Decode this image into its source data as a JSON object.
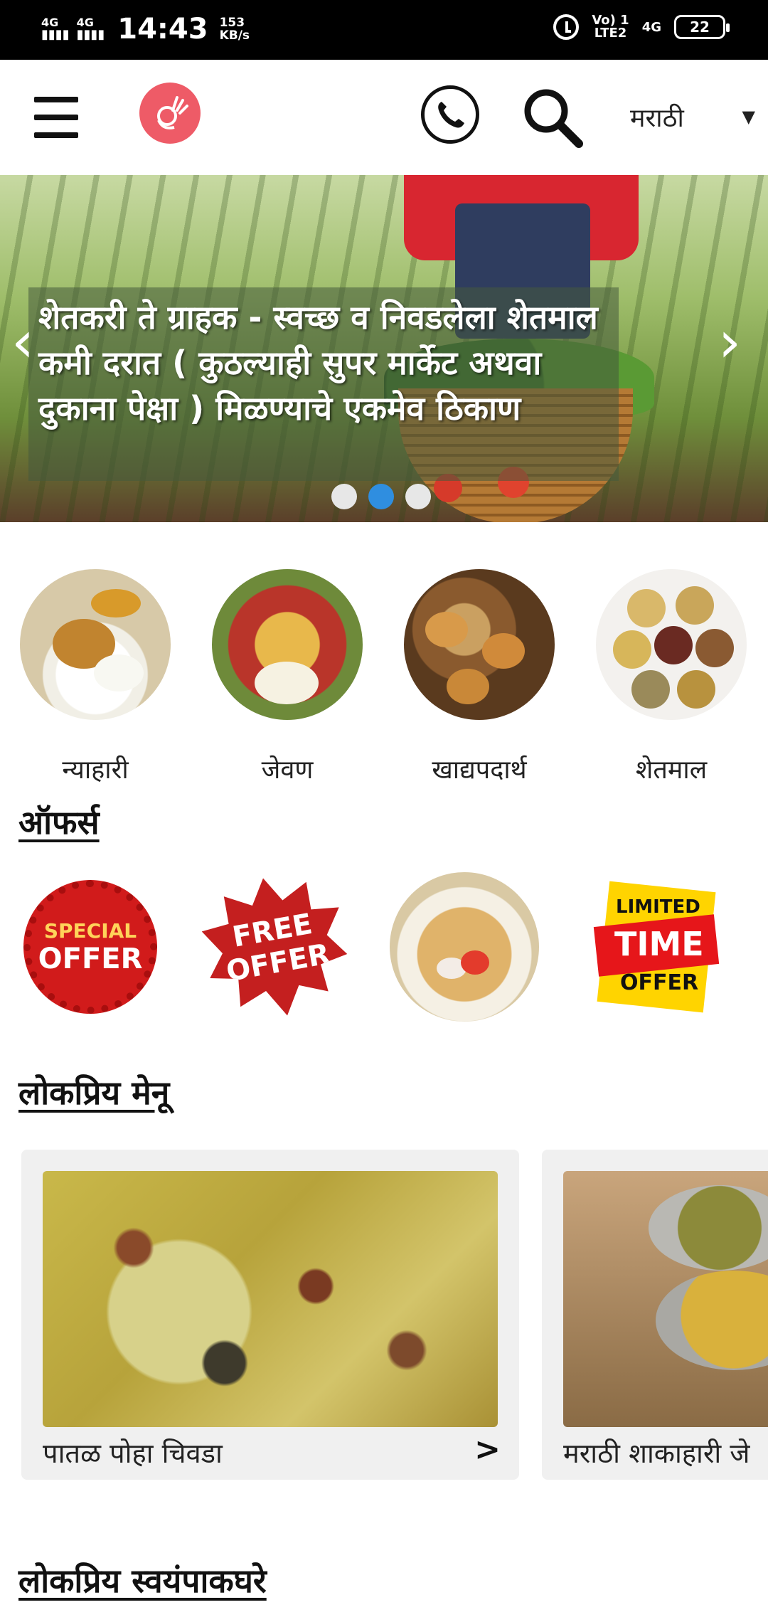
{
  "status_bar": {
    "signal1": "4G",
    "signal2": "4G",
    "time": "14:43",
    "speed_value": "153",
    "speed_unit": "KB/s",
    "volte_top": "Vo) 1",
    "volte_bottom": "LTE2",
    "net": "4G",
    "battery": "22"
  },
  "header": {
    "language": "मराठी",
    "language_caret": "▼",
    "icons": [
      "menu-icon",
      "logo-icon",
      "phone-icon",
      "search-icon"
    ]
  },
  "banner": {
    "text": "शेतकरी ते ग्राहक - स्वच्छ व निवडलेला शेतमाल कमी दरात ( कुठल्याही सुपर मार्केट अथवा दुकाना पेक्षा ) मिळण्याचे एकमेव ठिकाण",
    "prev": "‹",
    "next": "›",
    "dots_count": 3,
    "active_dot": 1,
    "accent_color": "#2f8ee0"
  },
  "categories": [
    {
      "label": "न्याहारी"
    },
    {
      "label": "जेवण"
    },
    {
      "label": "खाद्यपदार्थ"
    },
    {
      "label": "शेतमाल"
    }
  ],
  "offers": {
    "title": "ऑफर्स",
    "items": [
      {
        "line1": "SPECIAL",
        "line2": "OFFER"
      },
      {
        "line1": "FREE",
        "line2": "OFFER"
      },
      {
        "line1": "",
        "line2": ""
      },
      {
        "line1": "LIMITED",
        "line2": "TIME",
        "line3": "OFFER"
      }
    ]
  },
  "popular_menu": {
    "title": "लोकप्रिय मेनू",
    "items": [
      {
        "name": "पातळ पोहा चिवडा",
        "arrow": ">"
      },
      {
        "name": "मराठी शाकाहारी जे"
      }
    ]
  },
  "popular_kitchens": {
    "title": "लोकप्रिय स्वयंपाकघरे"
  }
}
